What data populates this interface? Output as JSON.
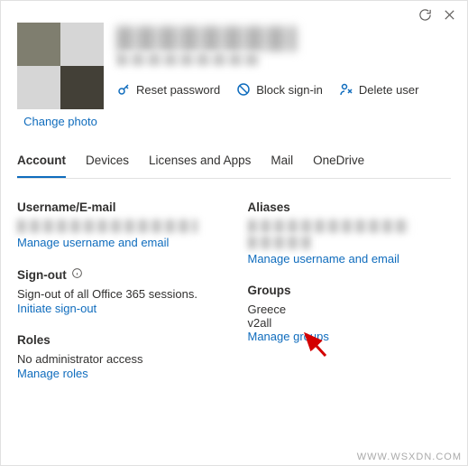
{
  "topControls": {
    "refresh": "refresh-icon",
    "close": "close-icon"
  },
  "header": {
    "changePhoto": "Change photo",
    "actions": {
      "reset": "Reset password",
      "block": "Block sign-in",
      "delete": "Delete user"
    }
  },
  "tabs": [
    {
      "label": "Account",
      "active": true
    },
    {
      "label": "Devices",
      "active": false
    },
    {
      "label": "Licenses and Apps",
      "active": false
    },
    {
      "label": "Mail",
      "active": false
    },
    {
      "label": "OneDrive",
      "active": false
    }
  ],
  "sections": {
    "username": {
      "heading": "Username/E-mail",
      "manageLink": "Manage username and email"
    },
    "signout": {
      "heading": "Sign-out",
      "desc": "Sign-out of all Office 365 sessions.",
      "link": "Initiate sign-out"
    },
    "roles": {
      "heading": "Roles",
      "desc": "No administrator access",
      "link": "Manage roles"
    },
    "aliases": {
      "heading": "Aliases",
      "manageLink": "Manage username and email"
    },
    "groups": {
      "heading": "Groups",
      "items": [
        "Greece",
        "v2all"
      ],
      "link": "Manage groups"
    }
  },
  "watermark": "WWW.WSXDN.COM"
}
